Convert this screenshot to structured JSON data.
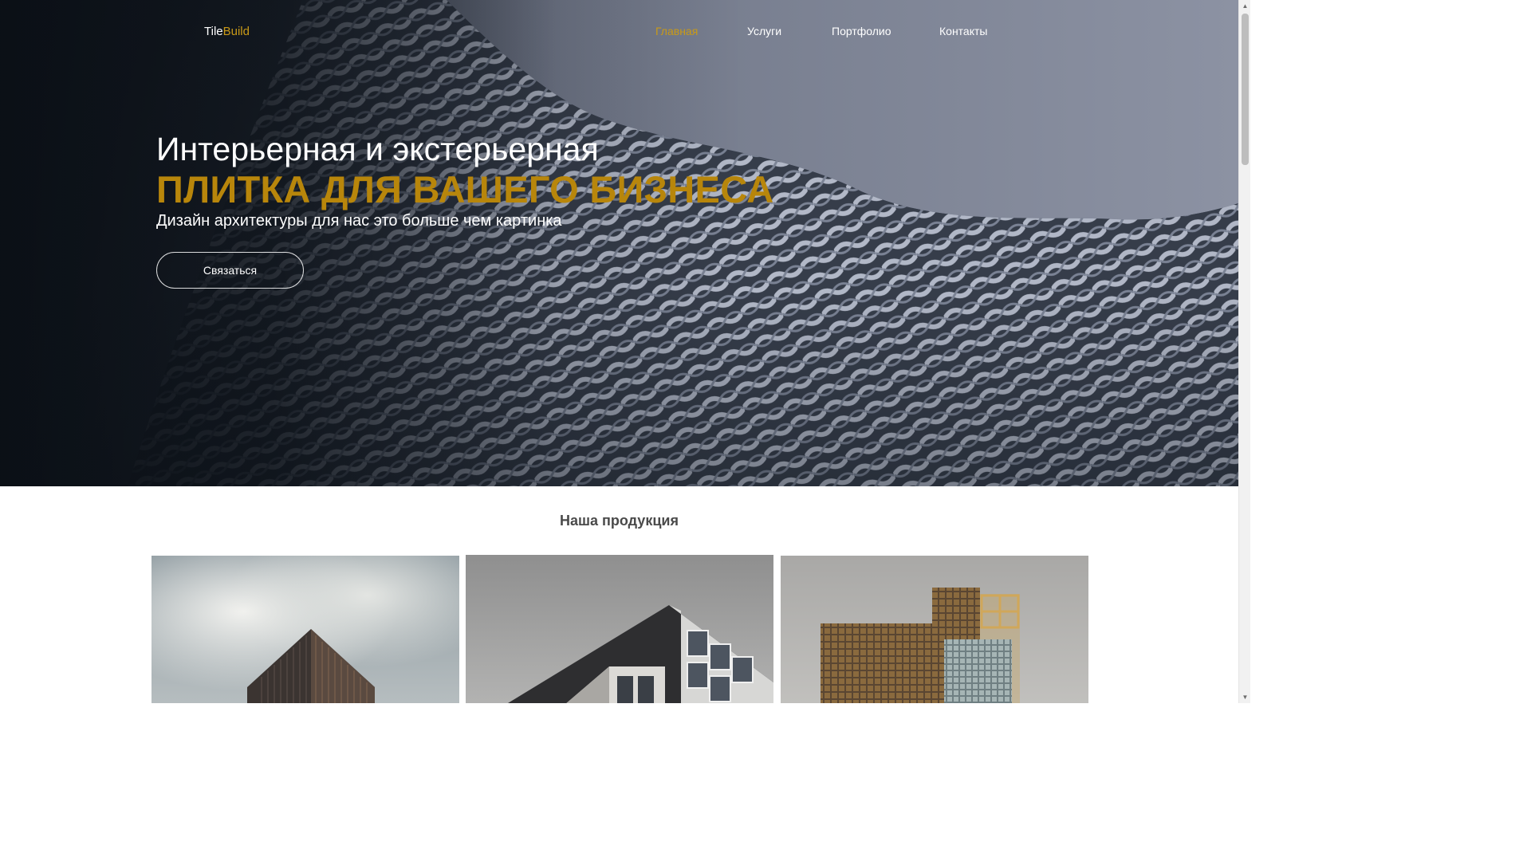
{
  "header": {
    "logo_part1": "Tile",
    "logo_part2": "Build",
    "nav": [
      {
        "label": "Главная",
        "active": true
      },
      {
        "label": "Услуги",
        "active": false
      },
      {
        "label": "Портфолио",
        "active": false
      },
      {
        "label": "Контакты",
        "active": false
      }
    ]
  },
  "hero": {
    "title": "Интерьерная и экстерьерная",
    "accent": "ПЛИТКА ДЛЯ ВАШЕГО БИЗНЕСА",
    "subtitle": "Дизайн архитектуры для нас это больше чем картинка",
    "cta_label": "Связаться"
  },
  "products": {
    "title": "Наша продукция",
    "cards": [
      {
        "image": "tower-sky-photo"
      },
      {
        "image": "modern-building-corner-photo"
      },
      {
        "image": "glass-highrise-photo"
      }
    ]
  },
  "colors": {
    "accent": "#b8860b",
    "nav_active": "#c99a17",
    "text_light": "#ffffff",
    "section_title": "#4a4a4a"
  },
  "icons": {
    "scroll_up": "chevron-up-icon",
    "scroll_down": "chevron-down-icon"
  }
}
